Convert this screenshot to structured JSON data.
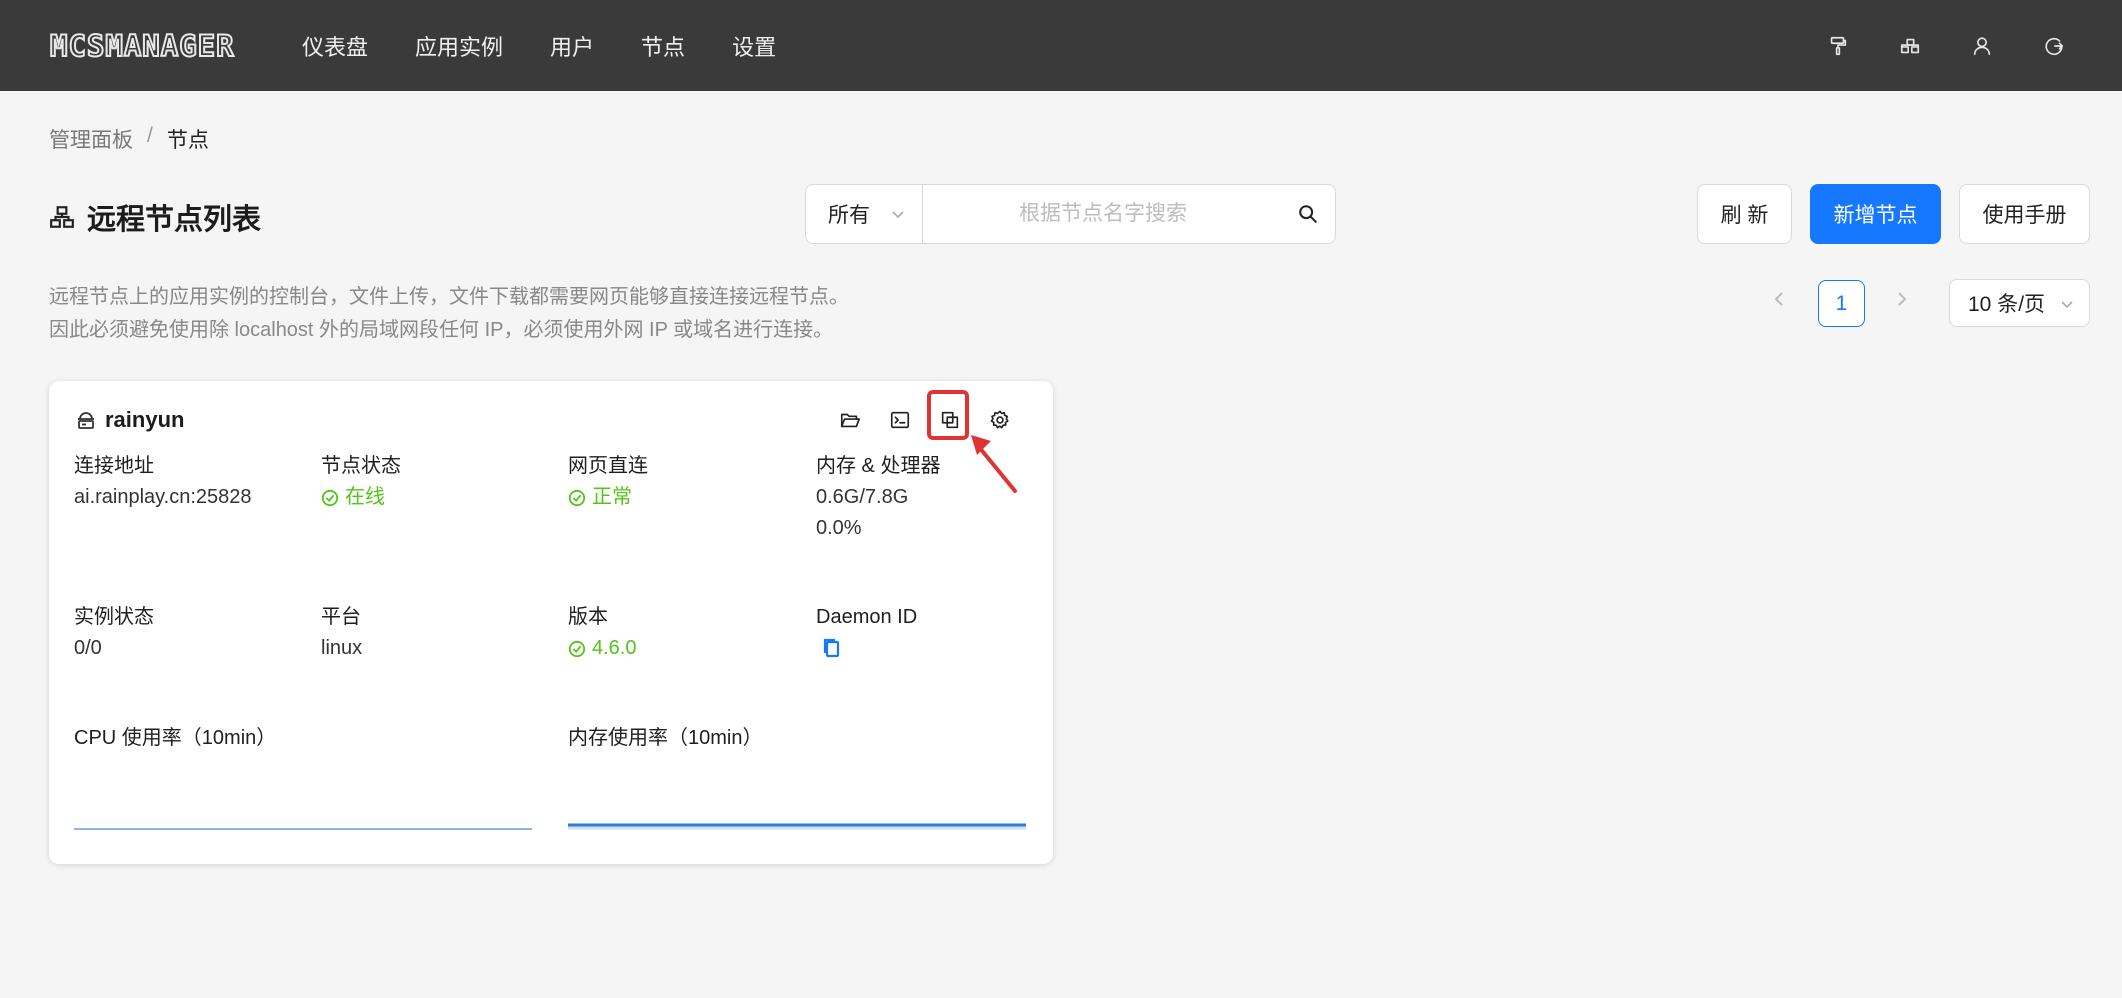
{
  "app": {
    "logo_text": "MCSMANAGER"
  },
  "nav": {
    "items": [
      "仪表盘",
      "应用实例",
      "用户",
      "节点",
      "设置"
    ]
  },
  "top_icons": [
    "paint-roller-icon",
    "cluster-icon",
    "user-icon",
    "logout-icon"
  ],
  "breadcrumb": {
    "parent": "管理面板",
    "separator": "/",
    "current": "节点"
  },
  "page": {
    "title": "远程节点列表",
    "description_line1": "远程节点上的应用实例的控制台，文件上传，文件下载都需要网页能够直接连接远程节点。",
    "description_line2": "因此必须避免使用除 localhost 外的局域网段任何 IP，必须使用外网 IP 或域名进行连接。"
  },
  "filter": {
    "selected": "所有"
  },
  "search": {
    "placeholder": "根据节点名字搜索",
    "value": ""
  },
  "buttons": {
    "refresh": "刷 新",
    "add_node": "新增节点",
    "manual": "使用手册"
  },
  "pagination": {
    "current_page": "1",
    "page_size": "10 条/页"
  },
  "nodes": [
    {
      "name": "rainyun",
      "address_label": "连接地址",
      "address": "ai.rainplay.cn:25828",
      "status_label": "节点状态",
      "status": "在线",
      "web_label": "网页直连",
      "web": "正常",
      "resource_label": "内存 & 处理器",
      "memory": "0.6G/7.8G",
      "cpu": "0.0%",
      "instance_label": "实例状态",
      "instances": "0/0",
      "platform_label": "平台",
      "platform": "linux",
      "version_label": "版本",
      "version": "4.6.0",
      "daemon_label": "Daemon ID",
      "cpu_chart_title": "CPU 使用率（10min）",
      "mem_chart_title": "内存使用率（10min）"
    }
  ],
  "colors": {
    "topbar": "#3a3a3a",
    "primary": "#1677ff",
    "success": "#52c41a",
    "highlight": "#e03434"
  }
}
